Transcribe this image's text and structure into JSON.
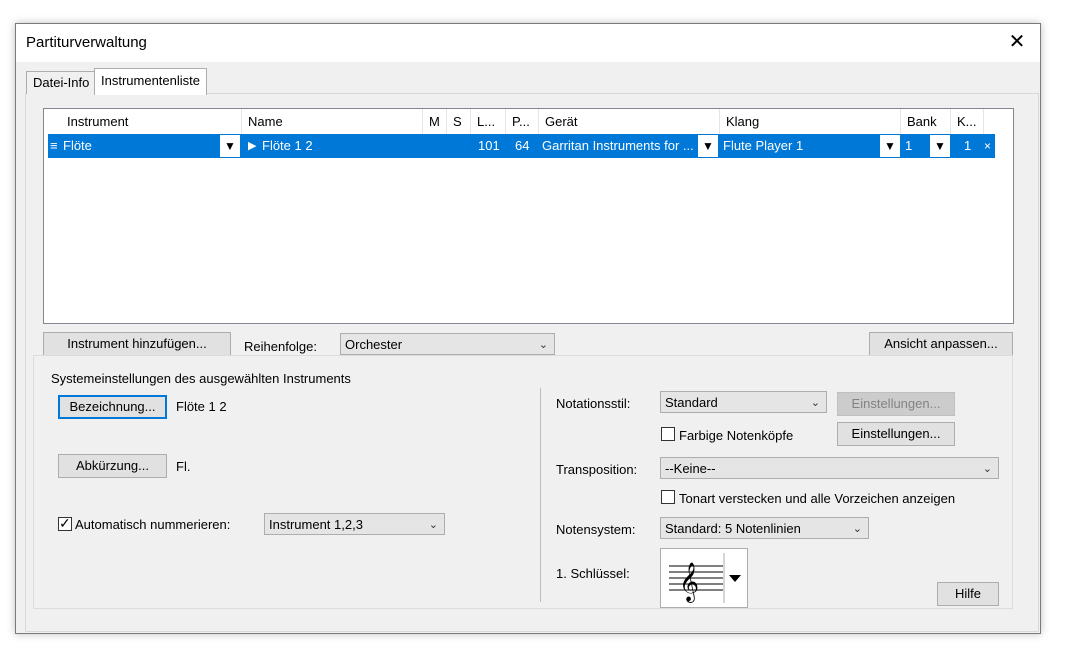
{
  "window": {
    "title": "Partiturverwaltung",
    "close_glyph": "✕"
  },
  "tabs": [
    {
      "label": "Datei-Info",
      "active": false
    },
    {
      "label": "Instrumentenliste",
      "active": true
    }
  ],
  "instrument_list": {
    "columns": [
      "Instrument",
      "Name",
      "M",
      "S",
      "L...",
      "P...",
      "Gerät",
      "Klang",
      "Bank",
      "K..."
    ],
    "rows": [
      {
        "handle": "≡",
        "instrument": "Flöte",
        "name_arrow": "▶",
        "name": "Flöte 1 2",
        "m": "",
        "s": "",
        "l": "101",
        "p": "64",
        "device": "Garritan Instruments for ...",
        "sound": "Flute Player 1",
        "bank": "1",
        "k": "1",
        "remove": "×"
      }
    ]
  },
  "toolbar": {
    "add_instrument": "Instrument hinzufügen...",
    "order_label": "Reihenfolge:",
    "order_value": "Orchester",
    "adjust_view": "Ansicht anpassen..."
  },
  "system_settings": {
    "group_title": "Systemeinstellungen des ausgewählten Instruments",
    "name_button": "Bezeichnung...",
    "name_value": "Flöte 1 2",
    "abbr_button": "Abkürzung...",
    "abbr_value": "Fl.",
    "auto_number_label": "Automatisch nummerieren:",
    "auto_number_checked": true,
    "auto_number_value": "Instrument 1,2,3",
    "notation_style_label": "Notationsstil:",
    "notation_style_value": "Standard",
    "settings_disabled": "Einstellungen...",
    "colored_noteheads_label": "Farbige Notenköpfe",
    "colored_noteheads_checked": false,
    "settings_enabled": "Einstellungen...",
    "transposition_label": "Transposition:",
    "transposition_value": "--Keine--",
    "hide_key_label": "Tonart verstecken und alle Vorzeichen anzeigen",
    "hide_key_checked": false,
    "staff_system_label": "Notensystem:",
    "staff_system_value": "Standard: 5 Notenlinien",
    "clef_label": "1. Schlüssel:",
    "clef_icon": "treble-clef-icon",
    "help_button": "Hilfe"
  },
  "colors": {
    "selection": "#0078d7",
    "dialog_bg": "#f0f0f0"
  }
}
